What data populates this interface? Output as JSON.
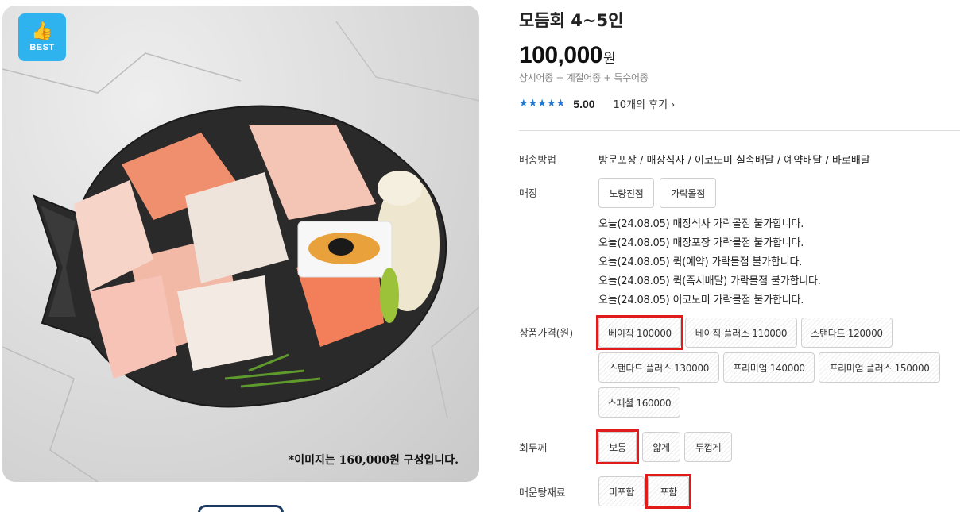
{
  "hero": {
    "badge_icon": "thumbs-up-icon",
    "badge_label": "BEST",
    "caption": "*이미지는 160,000원 구성입니다."
  },
  "product": {
    "title": "모듬회 4~5인",
    "price": "100,000",
    "price_unit": "원",
    "composition": "상시어종 + 계절어종 + 특수어종",
    "stars": "★★★★★",
    "rating": "5.00",
    "reviews_link": "10개의 후기 ›"
  },
  "delivery": {
    "label": "배송방법",
    "value": "방문포장 / 매장식사 / 이코노미 실속배달 / 예약배달 / 바로배달"
  },
  "store": {
    "label": "매장",
    "options": [
      "노량진점",
      "가락몰점"
    ],
    "notices": [
      "오늘(24.08.05) 매장식사 가락몰점 불가합니다.",
      "오늘(24.08.05) 매장포장 가락몰점 불가합니다.",
      "오늘(24.08.05) 퀵(예약) 가락몰점 불가합니다.",
      "오늘(24.08.05) 퀵(즉시배달) 가락몰점 불가합니다.",
      "오늘(24.08.05) 이코노미 가락몰점 불가합니다."
    ]
  },
  "price_options": {
    "label": "상품가격(원)",
    "options": [
      "베이직 100000",
      "베이직 플러스 110000",
      "스탠다드 120000",
      "스탠다드 플러스 130000",
      "프리미엄 140000",
      "프리미엄 플러스 150000",
      "스페셜 160000"
    ],
    "selected": "베이직 100000"
  },
  "thickness": {
    "label": "회두께",
    "options": [
      "보통",
      "얇게",
      "두껍게"
    ],
    "selected": "보통"
  },
  "stew": {
    "label": "매운탕재료",
    "options": [
      "미포함",
      "포함"
    ],
    "selected": "포함"
  },
  "colors": {
    "accent_blue": "#2fb3ee",
    "star_blue": "#1e7ad6",
    "highlight_red": "#e11b1b"
  }
}
